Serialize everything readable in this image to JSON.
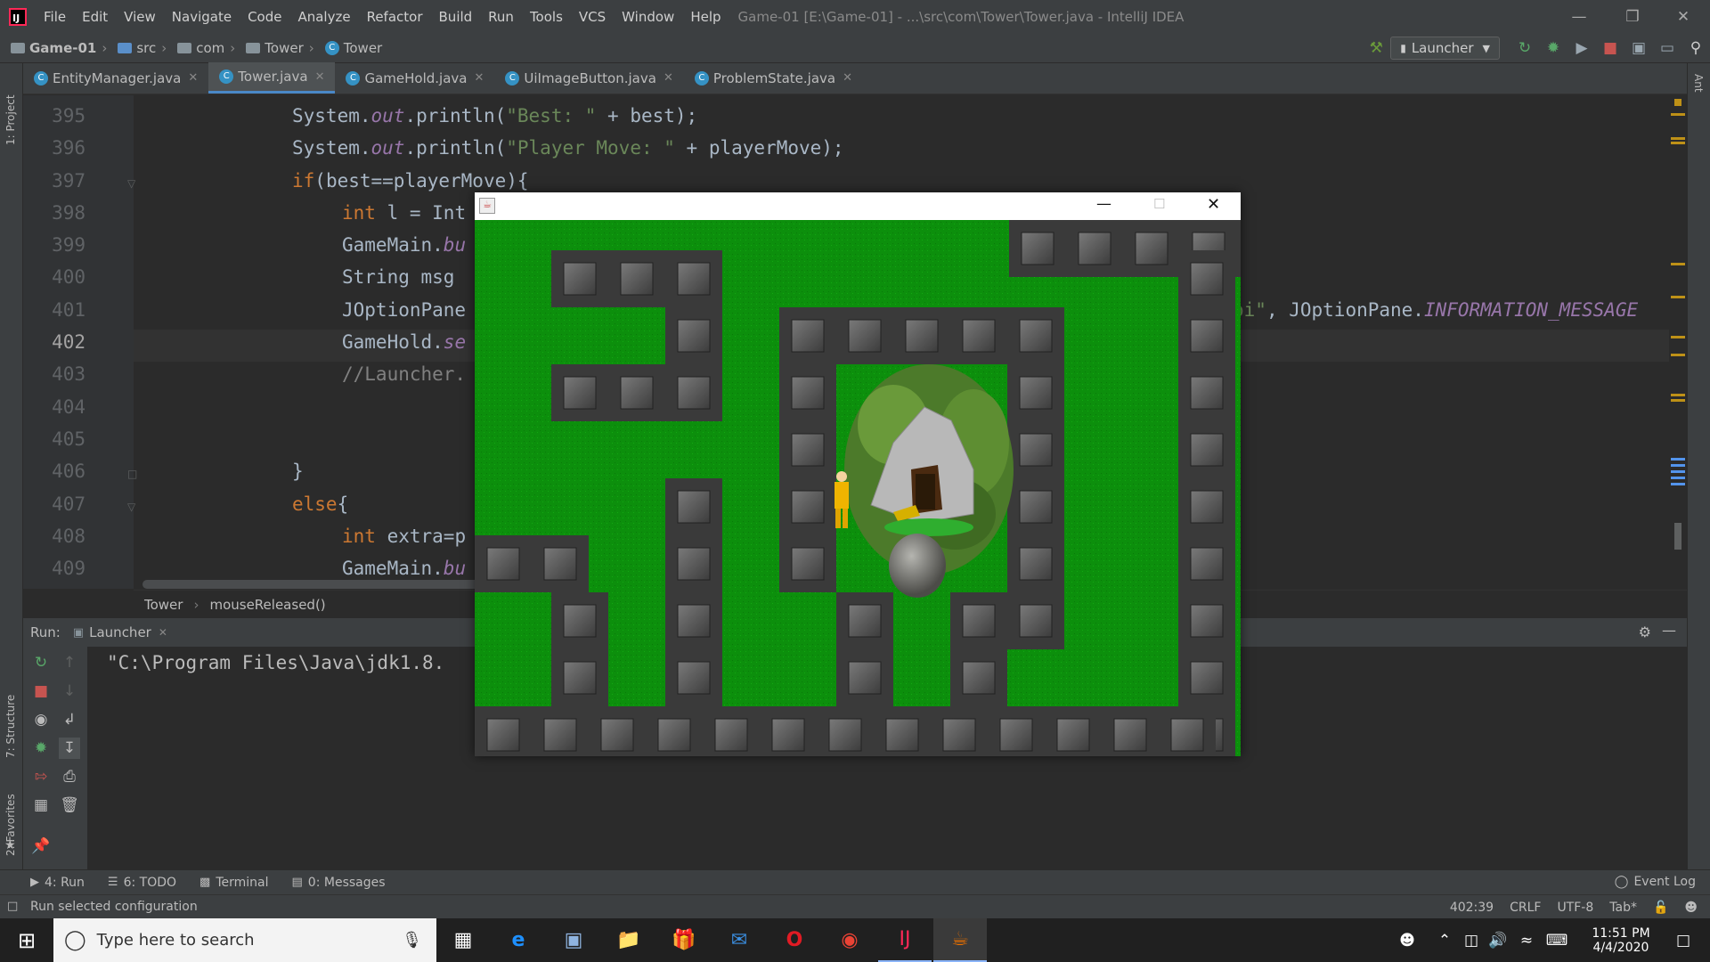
{
  "window": {
    "title": "Game-01 [E:\\Game-01] - ...\\src\\com\\Tower\\Tower.java - IntelliJ IDEA"
  },
  "menu": [
    "File",
    "Edit",
    "View",
    "Navigate",
    "Code",
    "Analyze",
    "Refactor",
    "Build",
    "Run",
    "Tools",
    "VCS",
    "Window",
    "Help"
  ],
  "navbar": {
    "crumbs": [
      "Game-01",
      "src",
      "com",
      "Tower",
      "Tower"
    ],
    "run_config": "Launcher"
  },
  "tabs": [
    {
      "label": "EntityManager.java",
      "active": false
    },
    {
      "label": "Tower.java",
      "active": true
    },
    {
      "label": "GameHold.java",
      "active": false
    },
    {
      "label": "UiImageButton.java",
      "active": false
    },
    {
      "label": "ProblemState.java",
      "active": false
    }
  ],
  "side_labels": {
    "project": "1: Project",
    "structure": "7: Structure",
    "favorites": "2: Favorites",
    "ant": "Ant"
  },
  "editor": {
    "line_numbers": [
      "395",
      "396",
      "397",
      "398",
      "399",
      "400",
      "401",
      "402",
      "403",
      "404",
      "405",
      "406",
      "407",
      "408",
      "409"
    ],
    "current_line": "402",
    "lines": {
      "l395a": "System.",
      "l395b": "out",
      "l395c": ".println(",
      "l395d": "\"Best: \"",
      "l395e": " + best);",
      "l396a": "System.",
      "l396b": "out",
      "l396c": ".println(",
      "l396d": "\"Player Move: \"",
      "l396e": " + playerMove);",
      "l397a": "if",
      "l397b": "(best==playerMove){",
      "l398a": "int",
      "l398b": " l = Int",
      "l399a": "GameMain.",
      "l399b": "bu",
      "l400": "String msg",
      "l401a": "JOptionPane",
      "l401r1": "oi\"",
      "l401r2": ", JOptionPane.",
      "l401r3": "INFORMATION_MESSAGE",
      "l402a": "GameHold.",
      "l402b": "se",
      "l403": "//Launcher.",
      "l406": "}",
      "l407a": "else",
      "l407b": "{",
      "l408a": "int",
      "l408b": " extra=p",
      "l409a": "GameMain.",
      "l409b": "bu"
    },
    "breadcrumbs": [
      "Tower",
      "mouseReleased()"
    ]
  },
  "run_panel": {
    "label": "Run:",
    "tab": "Launcher",
    "console": "\"C:\\Program Files\\Java\\jdk1.8."
  },
  "bottom_tabs": [
    {
      "label": "4: Run",
      "icon": "run-icon"
    },
    {
      "label": "6: TODO",
      "icon": "todo-icon"
    },
    {
      "label": "Terminal",
      "icon": "terminal-icon"
    },
    {
      "label": "0: Messages",
      "icon": "messages-icon"
    }
  ],
  "event_log": "Event Log",
  "status": {
    "message": "Run selected configuration",
    "position": "402:39",
    "line_sep": "CRLF",
    "encoding": "UTF-8",
    "indent": "Tab*"
  },
  "taskbar": {
    "search_placeholder": "Type here to search",
    "time": "11:51 PM",
    "date": "4/4/2020"
  },
  "game": {
    "grass": "#0c8c0c",
    "wall": "#555555",
    "player_color": "#f0b400",
    "boulder_color": "#777777"
  }
}
